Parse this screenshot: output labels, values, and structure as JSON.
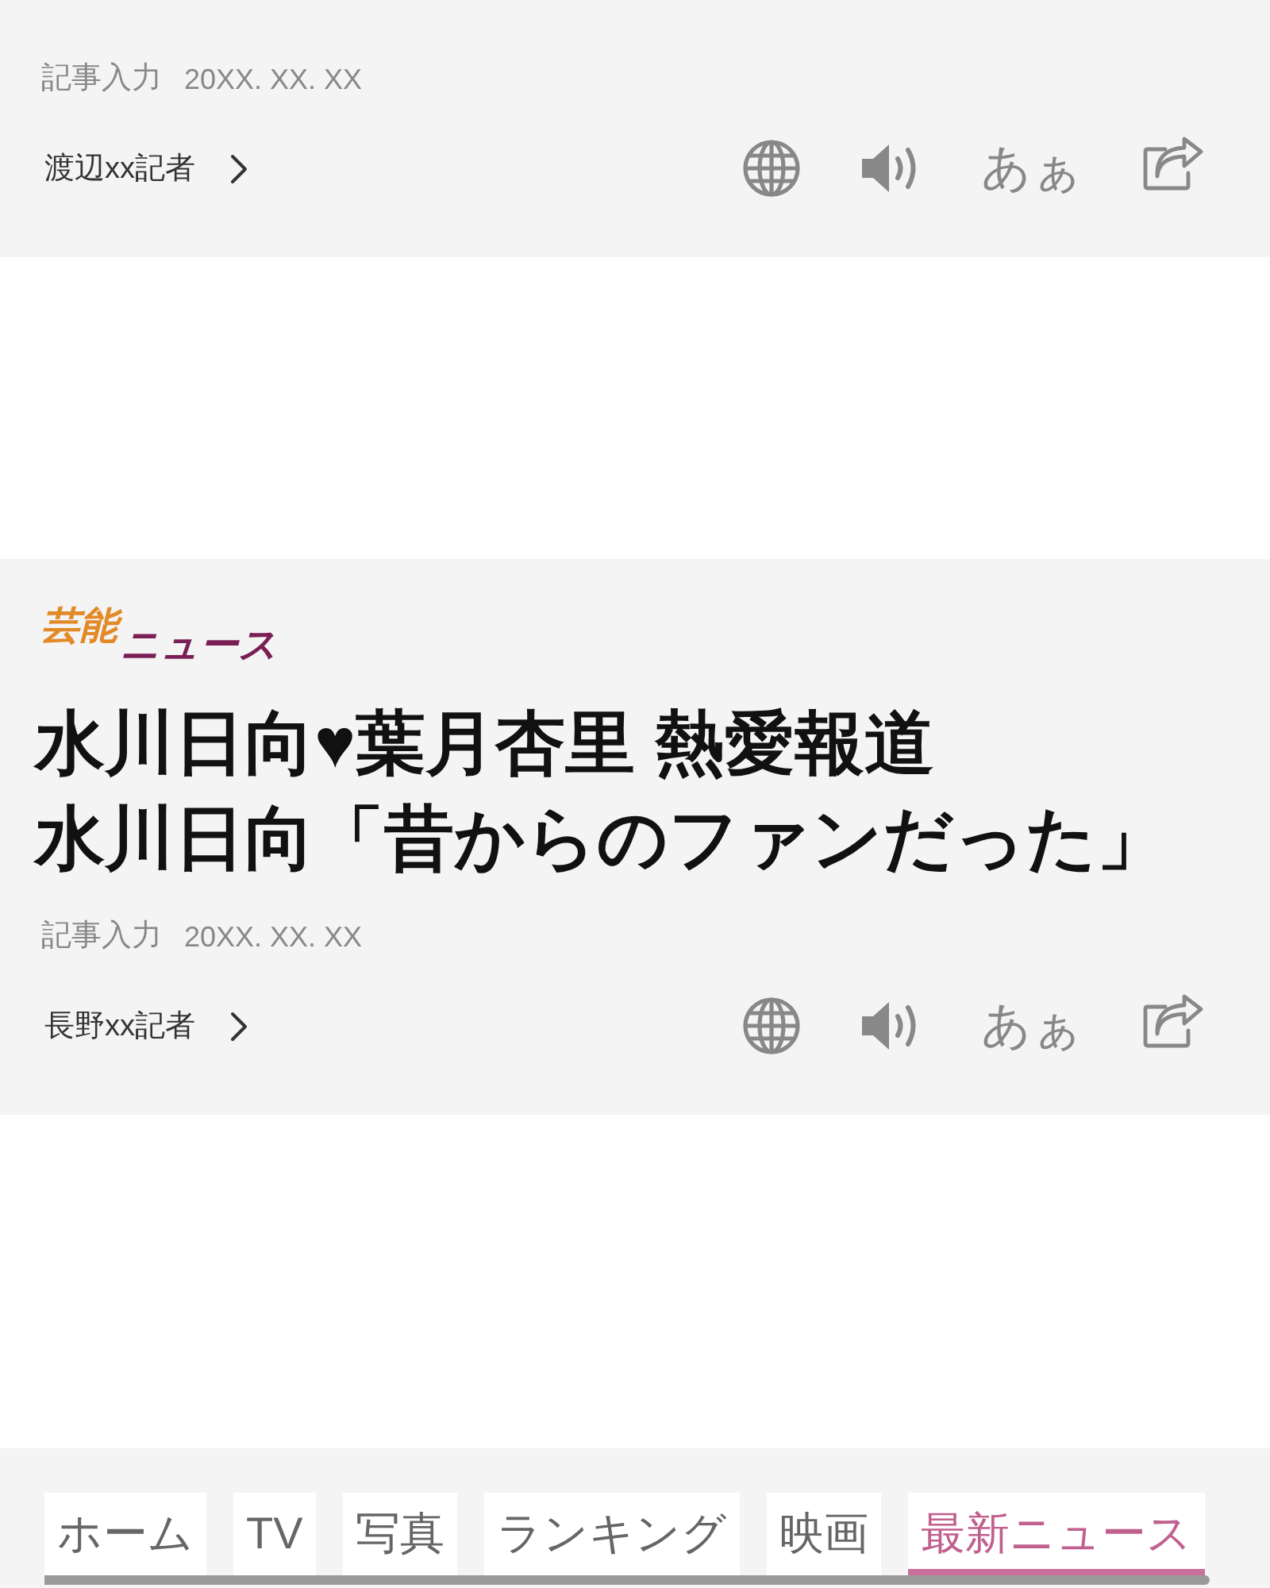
{
  "articles": [
    {
      "meta": {
        "label": "記事入力",
        "date": "20XX. XX. XX"
      },
      "reporter": "渡辺xx記者",
      "font_size_label": "あぁ"
    },
    {
      "category": {
        "lead": "芸能",
        "tail": "ニュース"
      },
      "headline_lines": [
        "水川日向♥葉月杏里 熱愛報道",
        "水川日向「昔からのファンだった」"
      ],
      "meta": {
        "label": "記事入力",
        "date": "20XX. XX. XX"
      },
      "reporter": "長野xx記者",
      "font_size_label": "あぁ"
    }
  ],
  "nav_tabs": [
    {
      "label": "ホーム",
      "selected": false
    },
    {
      "label": "TV",
      "selected": false
    },
    {
      "label": "写真",
      "selected": false
    },
    {
      "label": "ランキング",
      "selected": false
    },
    {
      "label": "映画",
      "selected": false
    },
    {
      "label": "最新ニュース",
      "selected": true
    }
  ]
}
